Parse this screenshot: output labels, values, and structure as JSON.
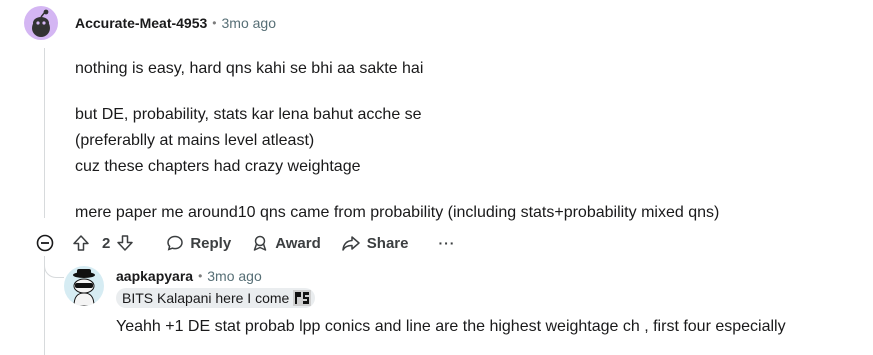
{
  "comment": {
    "author": "Accurate-Meat-4953",
    "time": "3mo ago",
    "paragraphs": [
      "nothing is easy, hard qns kahi se bhi aa sakte hai",
      "but DE, probability, stats kar lena bahut acche se",
      "(preferablly at mains level atleast)",
      "cuz these chapters had crazy weightage",
      "mere paper me around10 qns came from probability (including stats+probability mixed qns)"
    ],
    "vote_count": "2",
    "actions": {
      "reply": "Reply",
      "award": "Award",
      "share": "Share",
      "more": "···"
    }
  },
  "reply": {
    "author": "aapkapyara",
    "time": "3mo ago",
    "flair": "BITS Kalapani here I come",
    "text": "Yeahh +1 DE stat probab lpp conics and line are the highest weightage ch , first four especially"
  },
  "meta_separator": "•",
  "colors": {
    "avatar1_bg": "#d4b6f3",
    "avatar2_bg": "#d6ecf3",
    "muted": "#576f76",
    "thread_line": "#d7dadc",
    "flair_bg": "#eaedef"
  },
  "icons": [
    "reddit-snoo-icon",
    "upvote-icon",
    "downvote-icon",
    "reply-bubble-icon",
    "award-icon",
    "share-icon",
    "more-icon",
    "collapse-icon",
    "flair-emoji-icon"
  ]
}
